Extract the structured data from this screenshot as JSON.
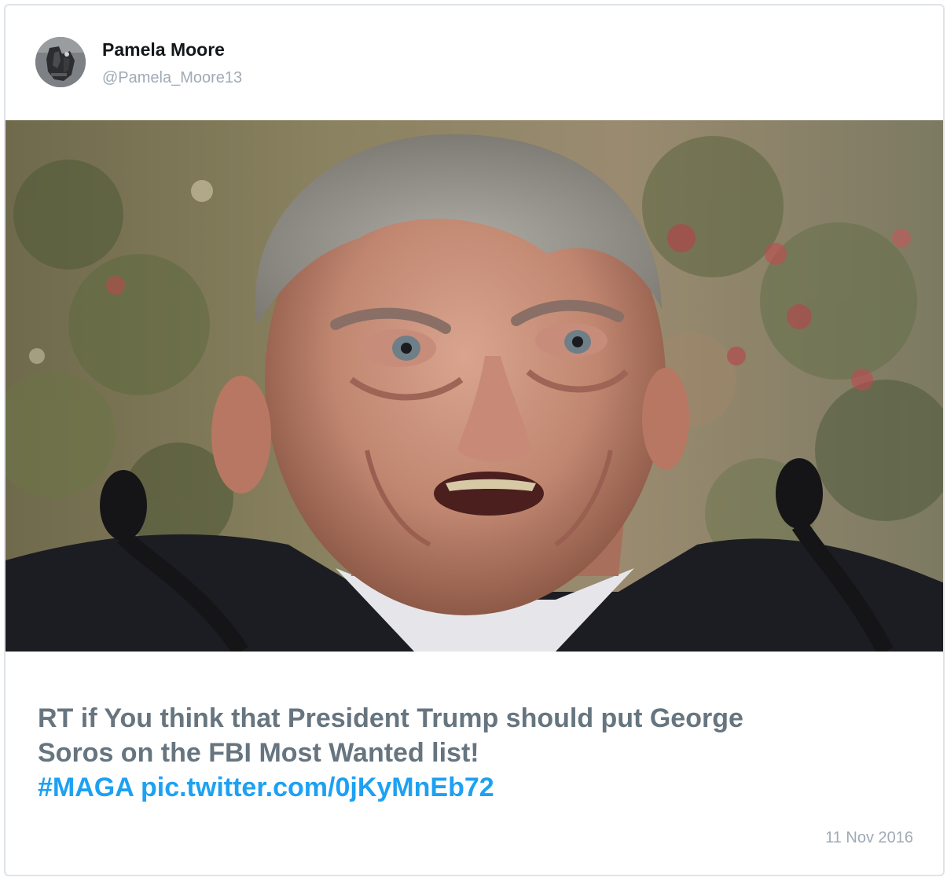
{
  "tweet": {
    "author": {
      "display_name": "Pamela Moore",
      "handle": "@Pamela_Moore13",
      "avatar_icon": "profile-avatar"
    },
    "media": {
      "type": "photo",
      "icon": "photo"
    },
    "text": {
      "line1": "RT if You think that President Trump should put George",
      "line2": "Soros on the FBI Most Wanted list!",
      "hashtag": "#MAGA",
      "link": "pic.twitter.com/0jKyMnEb72"
    },
    "date": "11 Nov 2016"
  },
  "colors": {
    "text_gray": "#66757f",
    "link_blue": "#1da1f2",
    "meta_gray": "#a0aab5",
    "border": "#dfe3e8"
  }
}
